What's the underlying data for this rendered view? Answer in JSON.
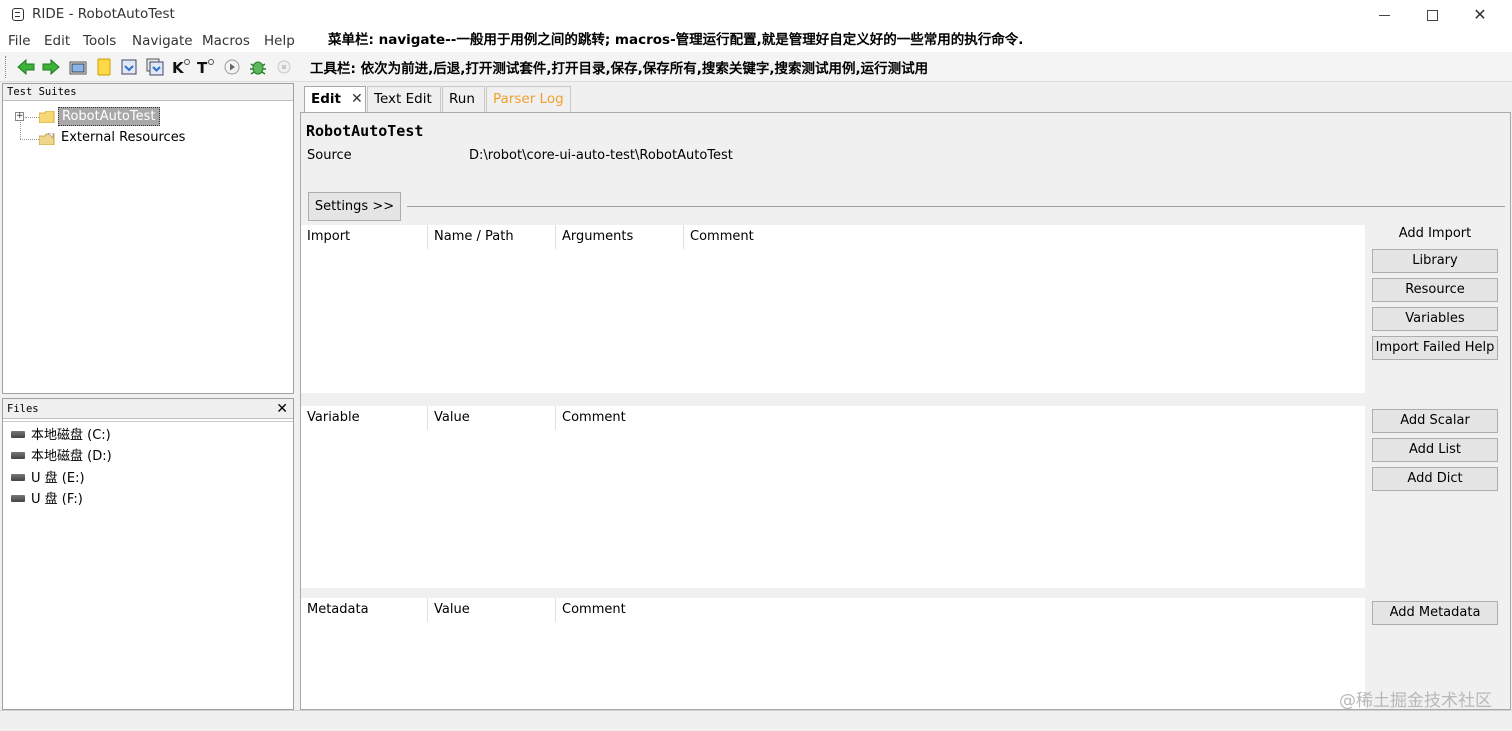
{
  "window": {
    "title": "RIDE - RobotAutoTest",
    "minimize": "—",
    "maximize": "□",
    "close": "✕"
  },
  "menubar": {
    "items": [
      "File",
      "Edit",
      "Tools",
      "Navigate",
      "Macros",
      "Help"
    ]
  },
  "annotations": {
    "menubar_note": "菜单栏: navigate--一般用于用例之间的跳转; macros-管理运行配置,就是管理好自定义好的一些常用的执行命令.",
    "toolbar_note": "工具栏: 依次为前进,后退,打开测试套件,打开目录,保存,保存所有,搜索关键字,搜索测试用例,运行测试用"
  },
  "toolbar": {
    "icons": [
      "forward-icon",
      "back-icon",
      "open-suite-icon",
      "open-directory-icon",
      "save-icon",
      "save-all-icon",
      "search-keyword-icon",
      "search-test-icon",
      "run-icon",
      "debug-icon",
      "stop-icon"
    ]
  },
  "test_suites": {
    "header": "Test Suites",
    "root": "RobotAutoTest",
    "expander": "+",
    "external": "External Resources"
  },
  "files": {
    "header": "Files",
    "close": "✕",
    "drives": [
      "本地磁盘 (C:)",
      "本地磁盘 (D:)",
      "U 盘 (E:)",
      "U 盘 (F:)"
    ]
  },
  "tabs": [
    {
      "label": "Edit",
      "close": "✕"
    },
    {
      "label": "Text Edit"
    },
    {
      "label": "Run"
    },
    {
      "label": "Parser Log"
    }
  ],
  "editor": {
    "suite_name": "RobotAutoTest",
    "source_label": "Source",
    "source_value": "D:\\robot\\core-ui-auto-test\\RobotAutoTest",
    "settings_button": "Settings >>",
    "import_table": {
      "headers": [
        "Import",
        "Name / Path",
        "Arguments",
        "Comment"
      ]
    },
    "variable_table": {
      "headers": [
        "Variable",
        "Value",
        "Comment"
      ]
    },
    "metadata_table": {
      "headers": [
        "Metadata",
        "Value",
        "Comment"
      ]
    },
    "add_import_label": "Add Import",
    "import_buttons": [
      "Library",
      "Resource",
      "Variables",
      "Import Failed Help"
    ],
    "variable_buttons": [
      "Add Scalar",
      "Add List",
      "Add Dict"
    ],
    "metadata_button": "Add Metadata"
  },
  "watermark": "@稀土掘金技术社区"
}
